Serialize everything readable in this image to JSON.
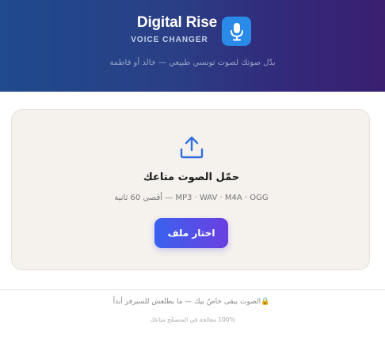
{
  "header": {
    "brand_title": "Digital Rise",
    "brand_subtitle": "VOICE CHANGER",
    "logo_icon": "microphone-icon",
    "tagline": "بدّل صوتك لصوت تونسي طبيعي — خالد أو فاطمة",
    "gradient_from": "#1f4a8c",
    "gradient_to": "#3a1f70",
    "logo_color": "#2a8ae8"
  },
  "upload": {
    "icon": "upload-icon",
    "title": "حمّل الصوت متاعك",
    "formats": "MP3 · WAV · M4A · OGG — أقصى 60 ثانية",
    "button_label": "اختار ملف",
    "accent": "#3a62ee"
  },
  "footer": {
    "lock_icon": "lock-icon",
    "privacy": "الصوت يبقى خاصّ بيك — ما يطلعش للسيرفر أبداً",
    "processing": "100% معالجة في المتصفّح متاعك"
  }
}
